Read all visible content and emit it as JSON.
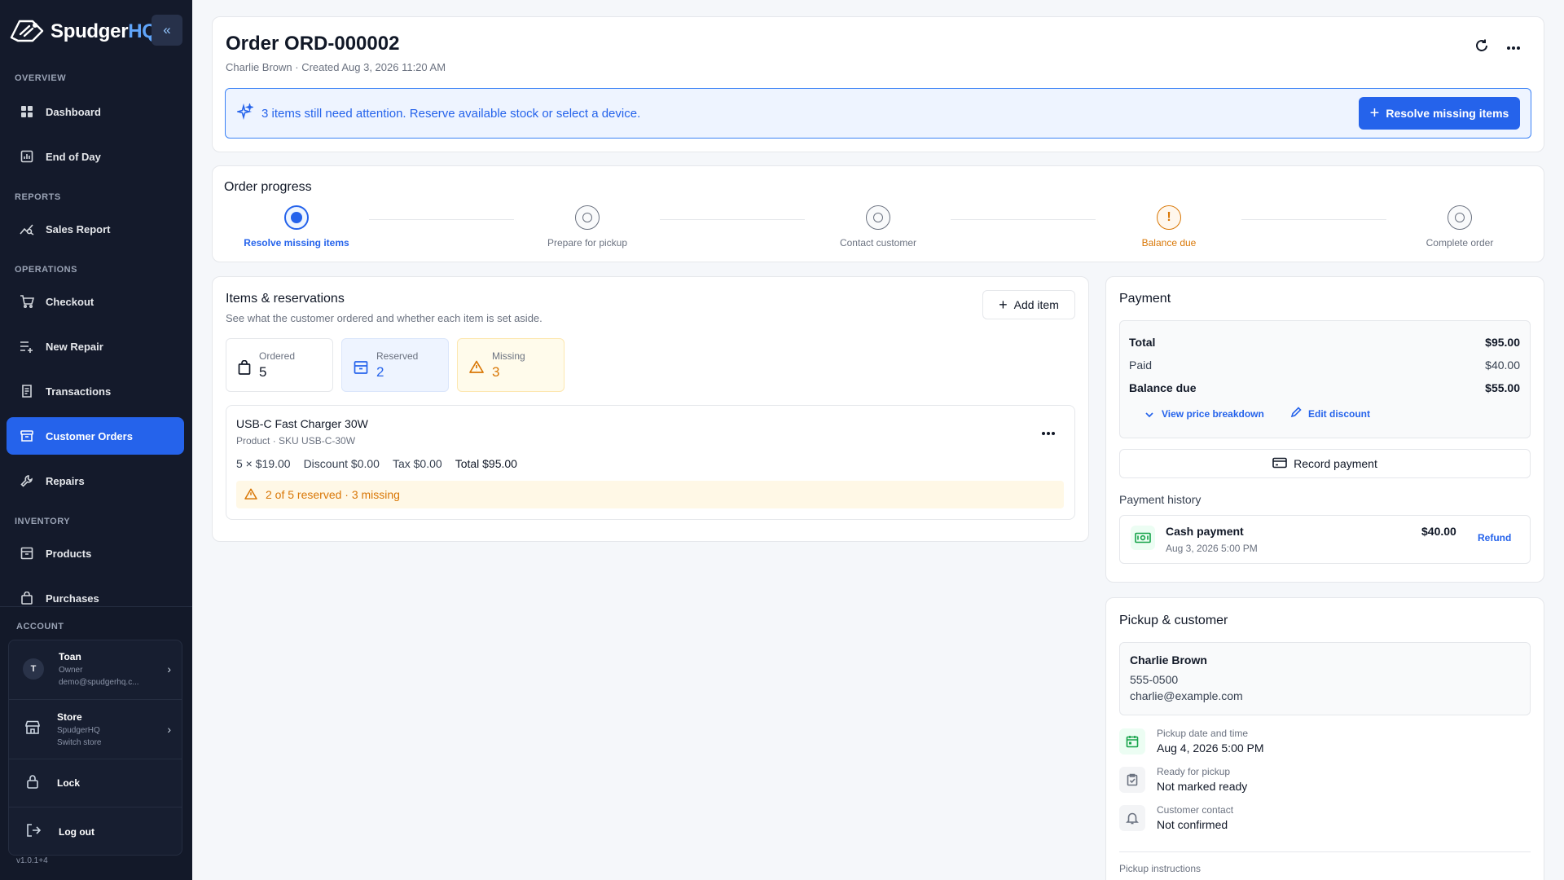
{
  "brand": {
    "name": "Spudger",
    "suffix": "HQ"
  },
  "sidebar": {
    "collapse_label": "«",
    "sections": {
      "overview": "OVERVIEW",
      "reports": "REPORTS",
      "operations": "OPERATIONS",
      "inventory": "INVENTORY",
      "account": "ACCOUNT"
    },
    "items": [
      {
        "label": "Dashboard",
        "icon": "dashboard-icon"
      },
      {
        "label": "End of Day",
        "icon": "chart-icon"
      },
      {
        "label": "Sales Report",
        "icon": "trend-icon"
      },
      {
        "label": "Checkout",
        "icon": "cart-icon"
      },
      {
        "label": "New Repair",
        "icon": "list-plus-icon"
      },
      {
        "label": "Transactions",
        "icon": "receipt-icon"
      },
      {
        "label": "Customer Orders",
        "icon": "box-icon",
        "active": true
      },
      {
        "label": "Repairs",
        "icon": "wrench-icon"
      },
      {
        "label": "Products",
        "icon": "archive-icon"
      },
      {
        "label": "Purchases",
        "icon": "bag-icon"
      }
    ],
    "account": {
      "user": {
        "initial": "T",
        "name": "Toan",
        "role": "Owner",
        "email": "demo@spudgerhq.c..."
      },
      "store": {
        "name": "Store",
        "store_name": "SpudgerHQ",
        "action": "Switch store"
      },
      "lock": "Lock",
      "logout": "Log out"
    },
    "version": "v1.0.1+4"
  },
  "order": {
    "title": "Order ORD-000002",
    "subtitle": "Charlie Brown · Created Aug 3, 2026 11:20 AM",
    "banner_text": "3 items still need attention. Reserve available stock or select a device.",
    "resolve_button": "Resolve missing items"
  },
  "progress": {
    "title": "Order progress",
    "steps": [
      {
        "label": "Resolve missing items",
        "state": "active"
      },
      {
        "label": "Prepare for pickup",
        "state": "pending"
      },
      {
        "label": "Contact customer",
        "state": "pending"
      },
      {
        "label": "Balance due",
        "state": "warning"
      },
      {
        "label": "Complete order",
        "state": "pending"
      }
    ]
  },
  "items": {
    "title": "Items & reservations",
    "subtitle": "See what the customer ordered and whether each item is set aside.",
    "add_button": "Add item",
    "stats": {
      "ordered": {
        "label": "Ordered",
        "value": "5"
      },
      "reserved": {
        "label": "Reserved",
        "value": "2"
      },
      "missing": {
        "label": "Missing",
        "value": "3"
      }
    },
    "line": {
      "name": "USB-C Fast Charger 30W",
      "meta": "Product · SKU USB-C-30W",
      "qty_price": "5 × $19.00",
      "discount": "Discount $0.00",
      "tax": "Tax $0.00",
      "total": "Total $95.00",
      "status": "2 of 5 reserved · 3 missing"
    }
  },
  "payment": {
    "title": "Payment",
    "total_label": "Total",
    "total_value": "$95.00",
    "paid_label": "Paid",
    "paid_value": "$40.00",
    "balance_label": "Balance due",
    "balance_value": "$55.00",
    "breakdown_link": "View price breakdown",
    "discount_link": "Edit discount",
    "record_button": "Record payment",
    "history_title": "Payment history",
    "history": [
      {
        "method": "Cash payment",
        "date": "Aug 3, 2026 5:00 PM",
        "amount": "$40.00",
        "action": "Refund"
      }
    ]
  },
  "pickup": {
    "title": "Pickup & customer",
    "customer": {
      "name": "Charlie Brown",
      "phone": "555-0500",
      "email": "charlie@example.com"
    },
    "rows": [
      {
        "label": "Pickup date and time",
        "value": "Aug 4, 2026 5:00 PM"
      },
      {
        "label": "Ready for pickup",
        "value": "Not marked ready"
      },
      {
        "label": "Customer contact",
        "value": "Not confirmed"
      }
    ],
    "instructions_label": "Pickup instructions"
  },
  "colors": {
    "sidebar_bg": "#141a2b",
    "accent": "#2563eb",
    "warning": "#d97706",
    "success": "#16a34a"
  }
}
